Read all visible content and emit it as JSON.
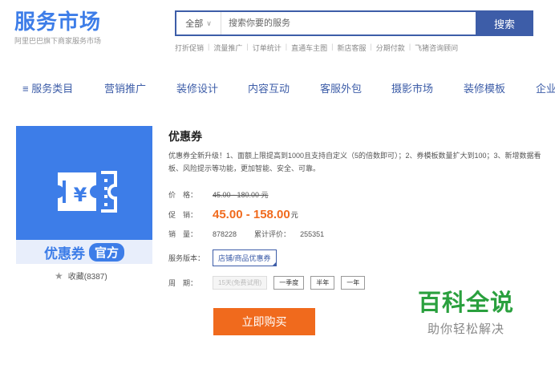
{
  "brand": {
    "title": "服务市场",
    "subtitle": "阿里巴巴旗下商家服务市场"
  },
  "search": {
    "category": "全部",
    "placeholder": "搜索你要的服务",
    "button": "搜索"
  },
  "hotlinks": [
    "打折促销",
    "流量推广",
    "订单统计",
    "直通车主图",
    "新店客服",
    "分期付款",
    "飞猪咨询顾问"
  ],
  "nav": {
    "menu_label": "服务类目",
    "items": [
      "营销推广",
      "装修设计",
      "内容互动",
      "客服外包",
      "摄影市场",
      "装修模板",
      "企业"
    ]
  },
  "product": {
    "image_caption": "优惠券",
    "image_badge": "官方",
    "favorites": "收藏(8387)",
    "title": "优惠券",
    "description": "优惠券全新升级！1、面额上限提高到1000且支持自定义（5的倍数即可）；2、券模板数量扩大到100；3、新增数据看板、风险提示等功能，更加智能、安全、可靠。",
    "price_label": "价　格：",
    "price_original": "45.00 - 180.00 元",
    "promo_label": "促　销：",
    "promo_price": "45.00 - 158.00",
    "promo_unit": "元",
    "sales_label": "销　量：",
    "sales_value": "878228",
    "rating_label": "累计评价：",
    "rating_value": "255351",
    "version_label": "服务版本：",
    "version_value": "店铺/商品优惠券",
    "period_label": "周　期：",
    "period_options": [
      "15天(免费试用)",
      "一季度",
      "半年",
      "一年"
    ],
    "buy_button": "立即购买"
  },
  "watermark": {
    "main": "百科全说",
    "sub": "助你轻松解决"
  },
  "colors": {
    "brand_blue": "#3d7de8",
    "nav_blue": "#3d5da8",
    "promo_orange": "#f06a1d",
    "watermark_green": "#2aa03e"
  }
}
